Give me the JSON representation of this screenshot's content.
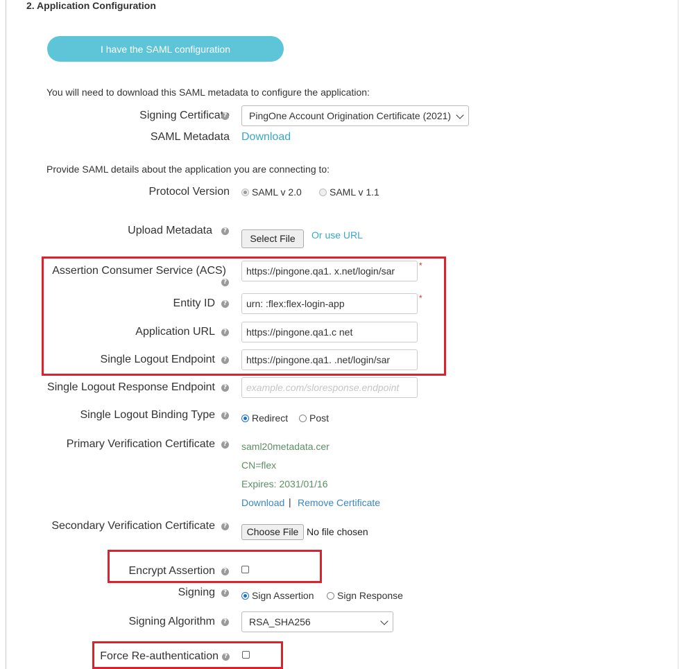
{
  "section": {
    "title": "2. Application Configuration"
  },
  "saml_button": "I have the SAML configuration",
  "download_intro": "You will need to download this SAML metadata to configure the application:",
  "signing_certificate": {
    "label": "Signing Certificate",
    "value": "PingOne Account Origination Certificate (2021)"
  },
  "saml_metadata": {
    "label": "SAML Metadata",
    "link": "Download"
  },
  "provide_intro": "Provide SAML details about the application you are connecting to:",
  "protocol_version": {
    "label": "Protocol Version",
    "options": [
      "SAML v 2.0",
      "SAML v 1.1"
    ],
    "selected": "SAML v 2.0"
  },
  "upload_metadata": {
    "label": "Upload Metadata",
    "button": "Select File",
    "url_link": "Or use URL"
  },
  "acs": {
    "label": "Assertion Consumer Service (ACS)",
    "value": "https://pingone.qa1.     x.net/login/sar",
    "required": "*"
  },
  "entity_id": {
    "label": "Entity ID",
    "value": "urn:           :flex:flex-login-app",
    "required": "*"
  },
  "application_url": {
    "label": "Application URL",
    "value": "https://pingone.qa1.c          net"
  },
  "slo_endpoint": {
    "label": "Single Logout Endpoint",
    "value": "https://pingone.qa1.          .net/login/sar"
  },
  "slo_response": {
    "label": "Single Logout Response Endpoint",
    "placeholder": "example.com/sloresponse.endpoint"
  },
  "slo_binding": {
    "label": "Single Logout Binding Type",
    "options": [
      "Redirect",
      "Post"
    ],
    "selected": "Redirect"
  },
  "primary_cert": {
    "label": "Primary Verification Certificate",
    "file": "saml20metadata.cer",
    "cn": "CN=flex",
    "expires": "Expires: 2031/01/16",
    "download": "Download",
    "separator": "|",
    "remove": "Remove Certificate"
  },
  "secondary_cert": {
    "label": "Secondary Verification Certificate",
    "button": "Choose File",
    "status": "No file chosen"
  },
  "encrypt_assertion": {
    "label": "Encrypt Assertion",
    "checked": false
  },
  "signing": {
    "label": "Signing",
    "options": [
      "Sign Assertion",
      "Sign Response"
    ],
    "selected": "Sign Assertion"
  },
  "signing_algorithm": {
    "label": "Signing Algorithm",
    "value": "RSA_SHA256"
  },
  "force_reauth": {
    "label": "Force Re-authentication",
    "checked": false
  },
  "help_glyph": "?",
  "colors": {
    "accent_button": "#5ec4d7",
    "link": "#3aa6c7",
    "highlight": "#d9232d",
    "cert_text": "#5b8f62"
  }
}
